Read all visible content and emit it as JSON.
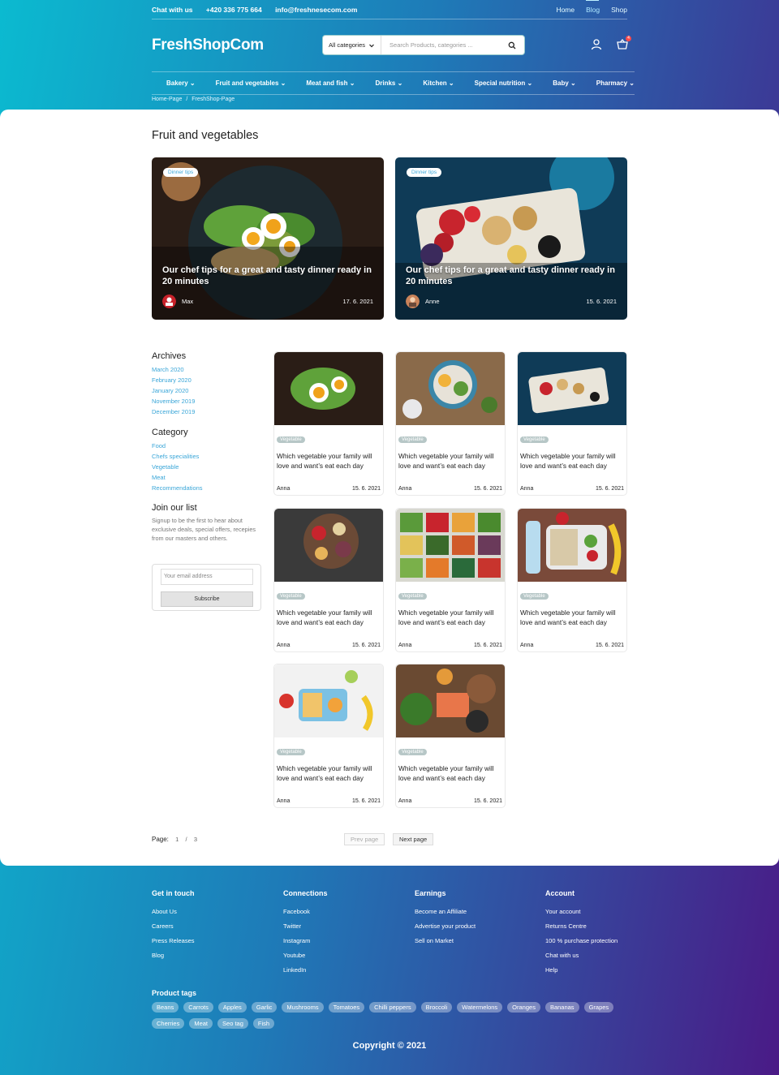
{
  "topbar": {
    "chat": "Chat with us",
    "phone": "+420 336 775 664",
    "email": "info@freshnesecom.com",
    "links": [
      "Home",
      "Blog",
      "Shop"
    ]
  },
  "header": {
    "logo": "FreshShopCom",
    "category_select": "All categories",
    "search_placeholder": "Search Products, categories ...",
    "cart_count": "4"
  },
  "nav": [
    "Bakery",
    "Fruit and vegetables",
    "Meat and fish",
    "Drinks",
    "Kitchen",
    "Special nutrition",
    "Baby",
    "Pharmacy"
  ],
  "breadcrumb": {
    "home": "Home-Page",
    "sep": "/",
    "current": "FreshShop-Page"
  },
  "page_title": "Fruit and vegetables",
  "featured": [
    {
      "tag": "Dinner tips",
      "title": "Our chef tips for a great and tasty dinner ready in 20 minutes",
      "author": "Max",
      "date": "17. 6. 2021"
    },
    {
      "tag": "Dinner tips",
      "title": "Our chef tips for a great and tasty dinner ready in 20 minutes",
      "author": "Anne",
      "date": "15. 6. 2021"
    }
  ],
  "sidebar": {
    "archives_title": "Archives",
    "archives": [
      "March 2020",
      "February 2020",
      "January 2020",
      "November 2019",
      "December 2019"
    ],
    "category_title": "Category",
    "categories": [
      "Food",
      "Chefs specialities",
      "Vegetable",
      "Meat",
      "Recommendations"
    ],
    "join_title": "Join our list",
    "join_text": "Signup to be the first to hear about exclusive deals, special offers, recepies from our masters and others.",
    "email_placeholder": "Your email address",
    "subscribe": "Subscribe"
  },
  "cards": [
    {
      "tag": "Vegetable",
      "title": "Which vegetable your family will love and want’s eat each day",
      "author": "Anna",
      "date": "15. 6. 2021"
    },
    {
      "tag": "Vegetable",
      "title": "Which vegetable your family will love and want’s eat each day",
      "author": "Anna",
      "date": "15. 6. 2021"
    },
    {
      "tag": "Vegetable",
      "title": "Which vegetable your family will love and want’s eat each day",
      "author": "Anna",
      "date": "15. 6. 2021"
    },
    {
      "tag": "Vegetable",
      "title": "Which vegetable your family will love and want’s eat each day",
      "author": "Anna",
      "date": "15. 6. 2021"
    },
    {
      "tag": "Vegetable",
      "title": "Which vegetable your family will love and want’s eat each day",
      "author": "Anna",
      "date": "15. 6. 2021"
    },
    {
      "tag": "Vegetable",
      "title": "Which vegetable your family will love and want’s eat each day",
      "author": "Anna",
      "date": "15. 6. 2021"
    },
    {
      "tag": "Vegetable",
      "title": "Which vegetable your family will love and want’s eat each day",
      "author": "Anna",
      "date": "15. 6. 2021"
    },
    {
      "tag": "Vegetable",
      "title": "Which vegetable your family will love and want’s eat each day",
      "author": "Anna",
      "date": "15. 6. 2021"
    }
  ],
  "pagination": {
    "label": "Page:",
    "current": "1",
    "sep": "/",
    "total": "3",
    "prev": "Prev page",
    "next": "Next page"
  },
  "footer": {
    "cols": [
      {
        "title": "Get in touch",
        "links": [
          "About Us",
          "Careers",
          "Press Releases",
          "Blog"
        ]
      },
      {
        "title": "Connections",
        "links": [
          "Facebook",
          "Twitter",
          "Instagram",
          "Youtube",
          "LinkedIn"
        ]
      },
      {
        "title": "Earnings",
        "links": [
          "Become an Affiliate",
          "Advertise your product",
          "Sell on Market"
        ]
      },
      {
        "title": "Account",
        "links": [
          "Your account",
          "Returns Centre",
          "100 % purchase protection",
          "Chat with us",
          "Help"
        ]
      }
    ],
    "tags_title": "Product tags",
    "tags": [
      "Beans",
      "Carrots",
      "Apples",
      "Garlic",
      "Mushrooms",
      "Tomatoes",
      "Chilli peppers",
      "Broccoli",
      "Watermelons",
      "Oranges",
      "Bananas",
      "Grapes",
      "Cherries",
      "Meat",
      "Seo tag",
      "Fish"
    ],
    "copyright": "Copyright © 2021"
  },
  "colors": {
    "accent": "#3aa6d8",
    "gradient_start": "#0bbad0",
    "gradient_end": "#4a1a86"
  }
}
